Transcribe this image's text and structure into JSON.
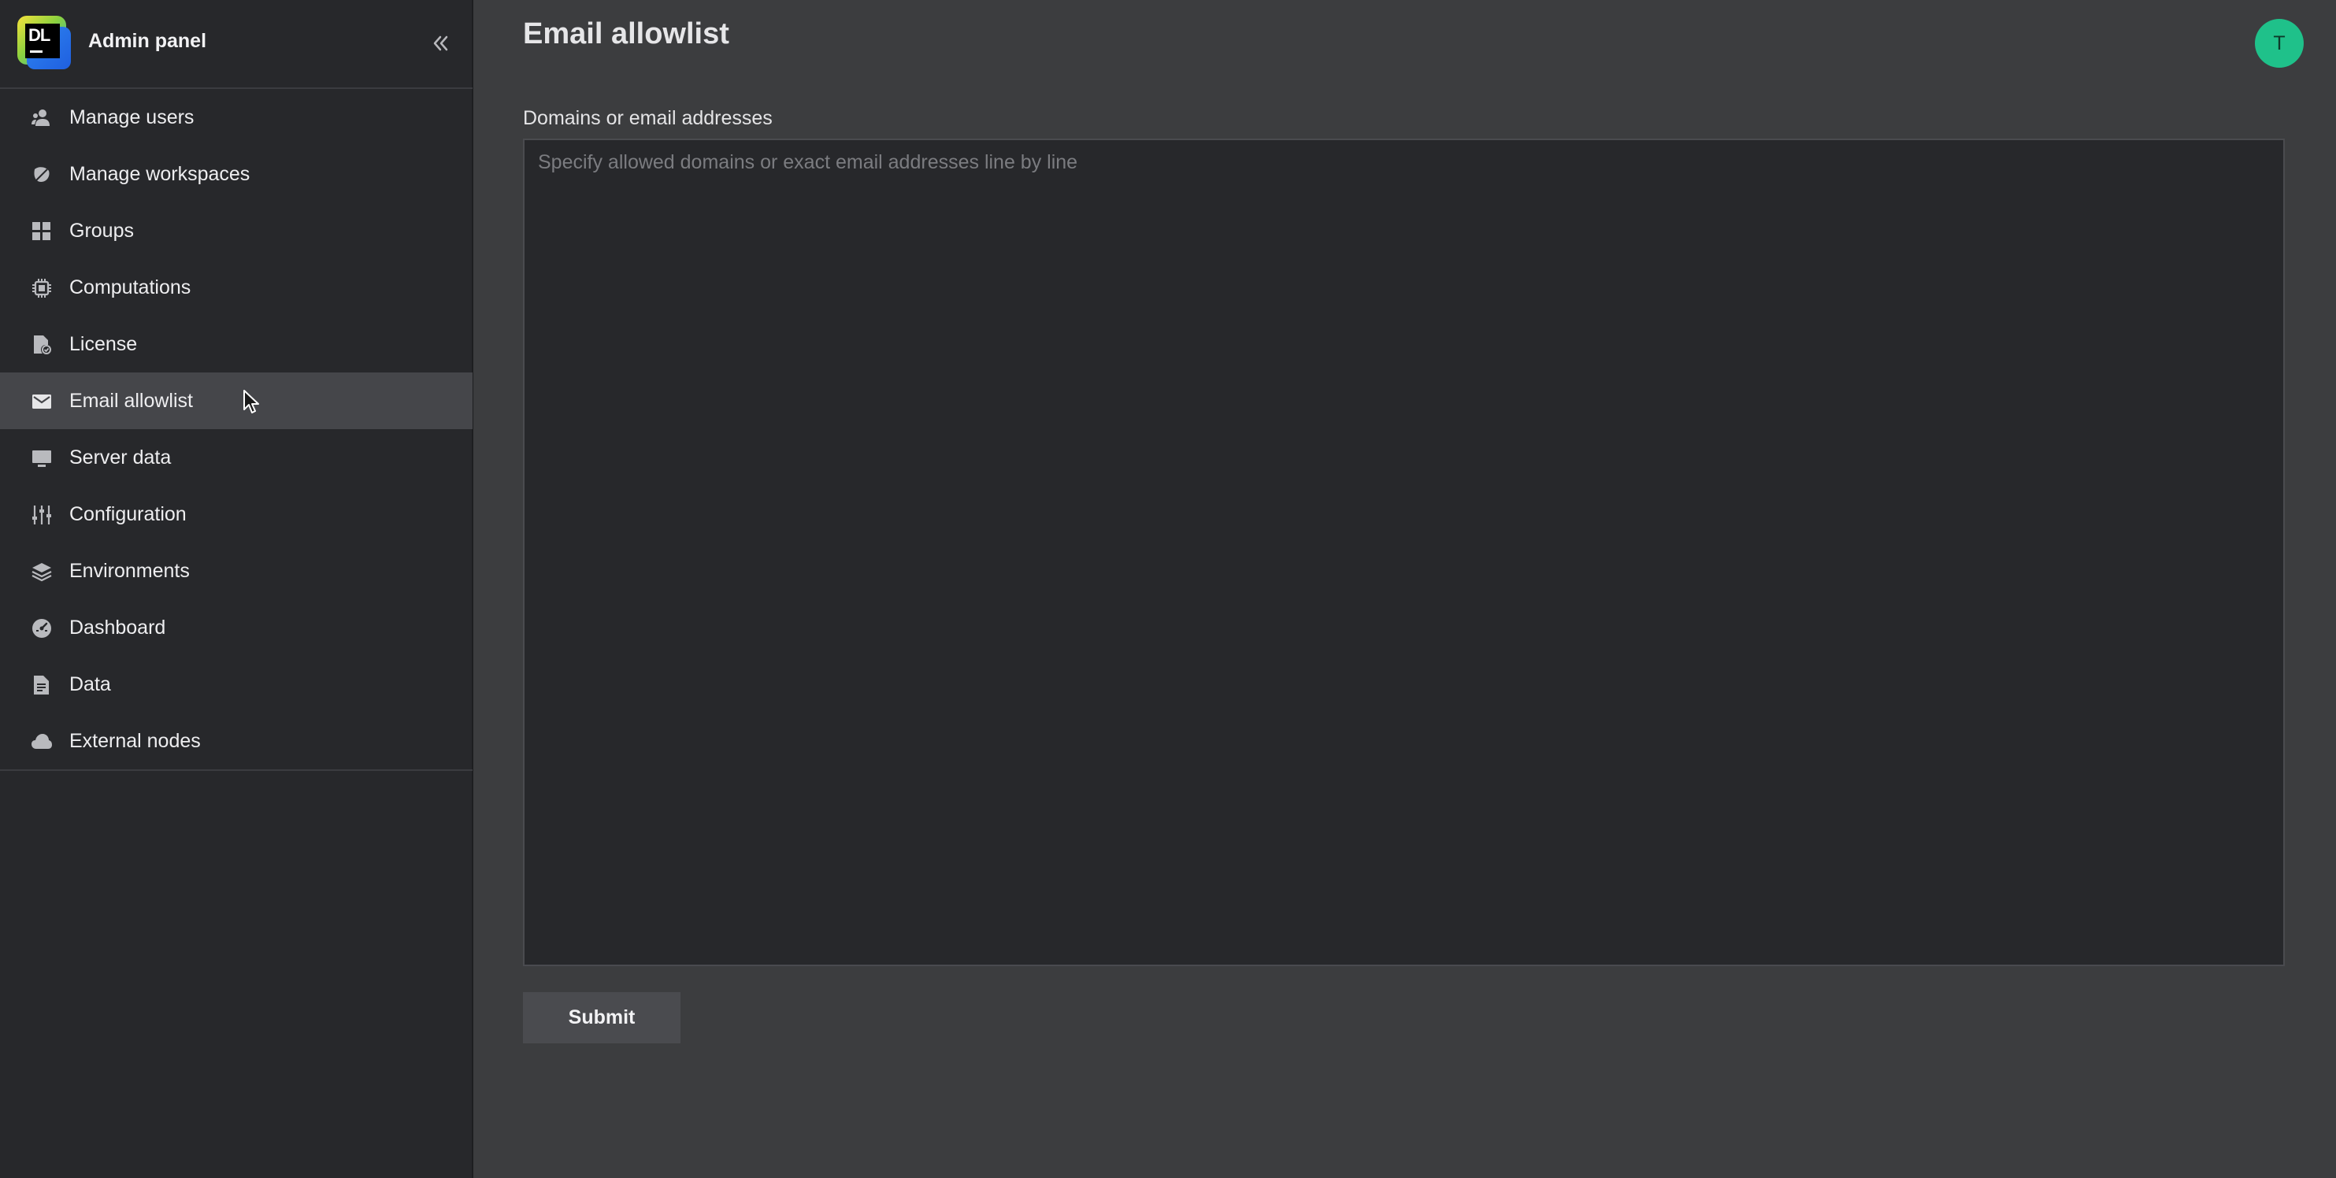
{
  "sidebar": {
    "logo_text": "DL",
    "title": "Admin panel",
    "items": [
      {
        "label": "Manage users",
        "icon": "users-icon"
      },
      {
        "label": "Manage workspaces",
        "icon": "workspaces-icon"
      },
      {
        "label": "Groups",
        "icon": "grid-icon"
      },
      {
        "label": "Computations",
        "icon": "chip-icon"
      },
      {
        "label": "License",
        "icon": "license-icon"
      },
      {
        "label": "Email allowlist",
        "icon": "mail-icon",
        "active": true
      },
      {
        "label": "Server data",
        "icon": "monitor-icon"
      },
      {
        "label": "Configuration",
        "icon": "sliders-icon"
      },
      {
        "label": "Environments",
        "icon": "layers-icon"
      },
      {
        "label": "Dashboard",
        "icon": "gauge-icon"
      },
      {
        "label": "Data",
        "icon": "document-icon"
      },
      {
        "label": "External nodes",
        "icon": "cloud-icon"
      }
    ]
  },
  "header": {
    "title": "Email allowlist",
    "avatar_initial": "T"
  },
  "form": {
    "field_label": "Domains or email addresses",
    "placeholder": "Specify allowed domains or exact email addresses line by line",
    "value": "",
    "submit_label": "Submit"
  },
  "colors": {
    "sidebar_bg": "#27282b",
    "main_bg": "#3c3d3f",
    "active_item_bg": "#45464a",
    "avatar_bg": "#1fc18a"
  }
}
